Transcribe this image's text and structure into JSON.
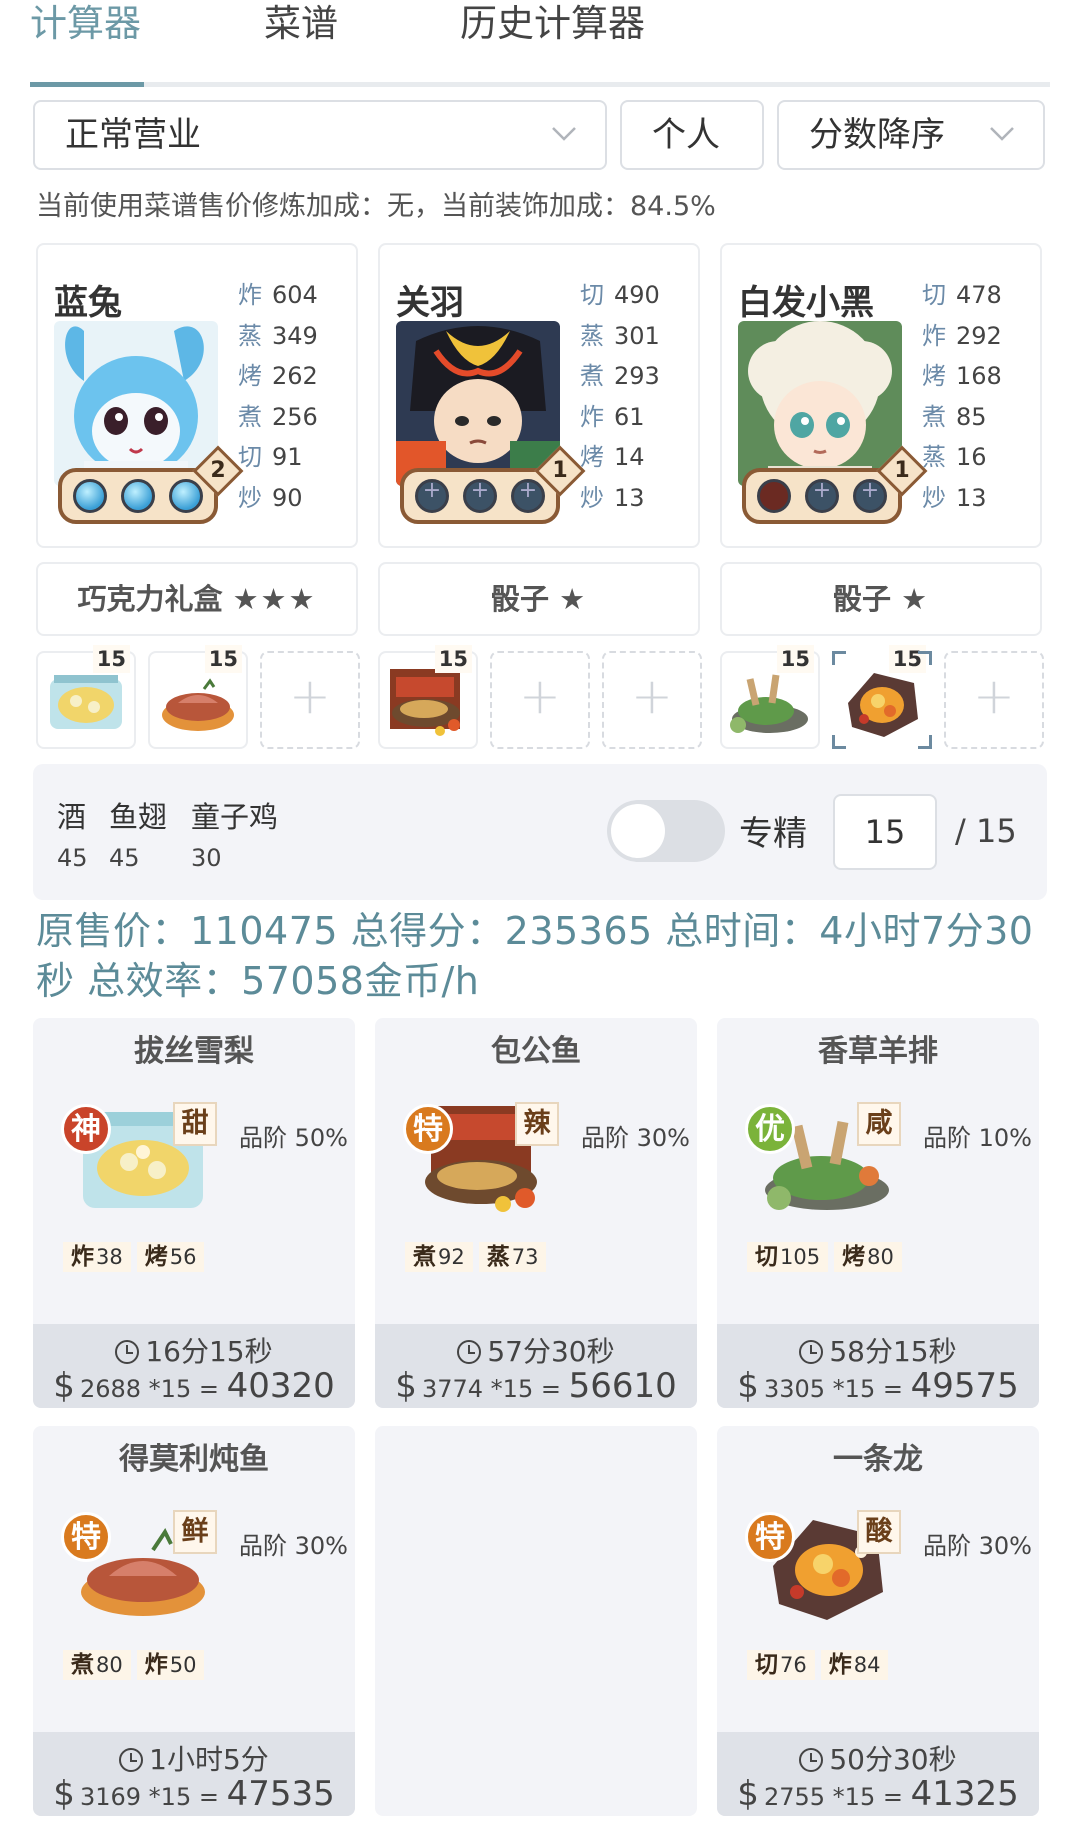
{
  "tabs": [
    "计算器",
    "菜谱",
    "历史计算器"
  ],
  "filters": {
    "mode": "正常营业",
    "scope": "个人",
    "sort": "分数降序"
  },
  "modifier_line": "当前使用菜谱售价修炼加成：无，当前装饰加成：84.5%",
  "chefs": [
    {
      "name": "蓝兔",
      "level": "2",
      "skills": [
        {
          "k": "炸",
          "v": "604"
        },
        {
          "k": "蒸",
          "v": "349"
        },
        {
          "k": "烤",
          "v": "262"
        },
        {
          "k": "煮",
          "v": "256"
        },
        {
          "k": "切",
          "v": "91"
        },
        {
          "k": "炒",
          "v": "90"
        }
      ]
    },
    {
      "name": "关羽",
      "level": "1",
      "skills": [
        {
          "k": "切",
          "v": "490"
        },
        {
          "k": "蒸",
          "v": "301"
        },
        {
          "k": "煮",
          "v": "293"
        },
        {
          "k": "炸",
          "v": "61"
        },
        {
          "k": "烤",
          "v": "14"
        },
        {
          "k": "炒",
          "v": "13"
        }
      ]
    },
    {
      "name": "白发小黑",
      "level": "1",
      "skills": [
        {
          "k": "切",
          "v": "478"
        },
        {
          "k": "炸",
          "v": "292"
        },
        {
          "k": "烤",
          "v": "168"
        },
        {
          "k": "煮",
          "v": "85"
        },
        {
          "k": "蒸",
          "v": "16"
        },
        {
          "k": "炒",
          "v": "13"
        }
      ]
    }
  ],
  "equipment": [
    {
      "name": "巧克力礼盒",
      "stars": "★★★"
    },
    {
      "name": "骰子",
      "stars": "★"
    },
    {
      "name": "骰子",
      "stars": "★"
    }
  ],
  "dish_slot_qty": [
    "15",
    "15",
    "15",
    "15",
    "15"
  ],
  "condiments": {
    "labels": [
      "酒",
      "鱼翅",
      "童子鸡"
    ],
    "values": [
      "45",
      "45",
      "30"
    ],
    "toggle_label": "专精",
    "count": "15",
    "max": "/ 15"
  },
  "summary": "原售价：110475 总得分：235365 总时间：4小时7分30秒 总效率：57058金币/h",
  "recipes": [
    {
      "name": "拔丝雪梨",
      "rarity": "神",
      "rarity_color": "#c9442a",
      "taste": "甜",
      "grade": "品阶 50%",
      "req1_k": "炸",
      "req1_v": "38",
      "req2_k": "烤",
      "req2_v": "56",
      "time": "16分15秒",
      "dollar": "$",
      "unit": "2688 *15",
      "eq": " = ",
      "total": "40320"
    },
    {
      "name": "包公鱼",
      "rarity": "特",
      "rarity_color": "#d97a1e",
      "taste": "辣",
      "grade": "品阶 30%",
      "req1_k": "煮",
      "req1_v": "92",
      "req2_k": "蒸",
      "req2_v": "73",
      "time": "57分30秒",
      "dollar": "$",
      "unit": "3774 *15",
      "eq": " = ",
      "total": "56610"
    },
    {
      "name": "香草羊排",
      "rarity": "优",
      "rarity_color": "#7bb33a",
      "taste": "咸",
      "grade": "品阶 10%",
      "req1_k": "切",
      "req1_v": "105",
      "req2_k": "烤",
      "req2_v": "80",
      "time": "58分15秒",
      "dollar": "$",
      "unit": "3305 *15",
      "eq": " = ",
      "total": "49575"
    },
    {
      "name": "得莫利炖鱼",
      "rarity": "特",
      "rarity_color": "#d97a1e",
      "taste": "鲜",
      "grade": "品阶 30%",
      "req1_k": "煮",
      "req1_v": "80",
      "req2_k": "炸",
      "req2_v": "50",
      "time": "1小时5分",
      "dollar": "$",
      "unit": "3169 *15",
      "eq": " = ",
      "total": "47535"
    },
    {
      "name": "一条龙",
      "rarity": "特",
      "rarity_color": "#d97a1e",
      "taste": "酸",
      "grade": "品阶 30%",
      "req1_k": "切",
      "req1_v": "76",
      "req2_k": "炸",
      "req2_v": "84",
      "time": "50分30秒",
      "dollar": "$",
      "unit": "2755 *15",
      "eq": " = ",
      "total": "41325"
    }
  ],
  "icons": {
    "chevron": "chevron-down-icon",
    "clock": "clock-icon",
    "plus": "plus-icon"
  }
}
